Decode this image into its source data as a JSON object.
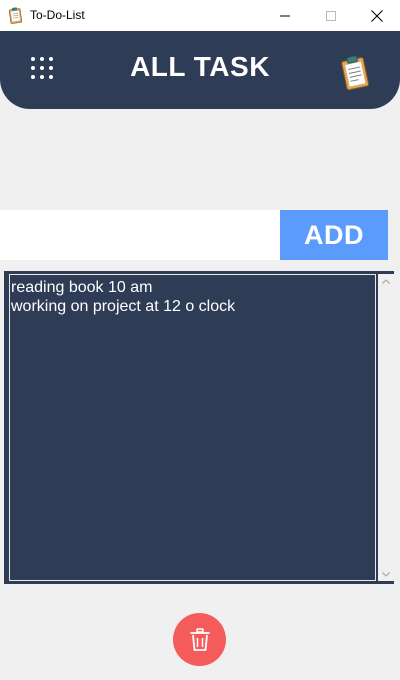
{
  "window": {
    "title": "To-Do-List",
    "icon": "clipboard-icon"
  },
  "header": {
    "title": "ALL TASK",
    "menu_icon": "grid-dots-icon",
    "logo_icon": "clipboard-icon"
  },
  "input": {
    "value": "",
    "placeholder": ""
  },
  "add_button": {
    "label": "ADD"
  },
  "tasks": [
    "reading book 10 am",
    "working on project at 12 o clock"
  ],
  "delete_button": {
    "icon": "trash-icon"
  },
  "colors": {
    "header_bg": "#2f3c56",
    "list_bg": "#2f3c56",
    "add_button_bg": "#5b9bfc",
    "delete_button_bg": "#f45b5b",
    "page_bg": "#f0f0f0"
  }
}
